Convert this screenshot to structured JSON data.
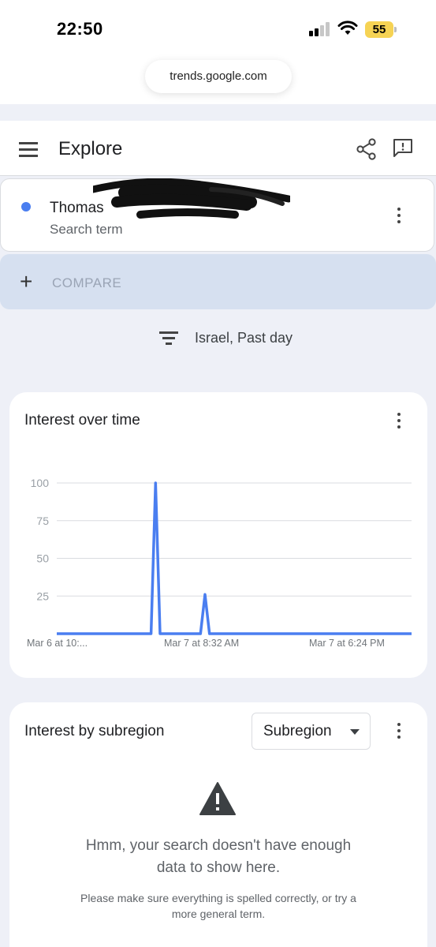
{
  "status_bar": {
    "time": "22:50",
    "battery": "55",
    "url": "trends.google.com"
  },
  "header": {
    "title": "Explore",
    "icons": [
      "menu-icon",
      "share-icon",
      "feedback-icon"
    ]
  },
  "term": {
    "name": "Thomas",
    "sub": "Search term",
    "color": "#4a7ef0"
  },
  "compare": {
    "label": "COMPARE"
  },
  "filter": {
    "label": "Israel, Past day"
  },
  "interest_over_time": {
    "title": "Interest over time"
  },
  "chart_data": {
    "type": "line",
    "y_ticks": [
      "100",
      "75",
      "50",
      "25"
    ],
    "x_tick_labels": [
      "Mar 6 at 10:...",
      "Mar 7 at 8:32 AM",
      "Mar 7 at 6:24 PM"
    ],
    "ylim": [
      0,
      100
    ],
    "grid": true,
    "series_color": "#4a7ef0",
    "values": [
      0,
      0,
      0,
      0,
      0,
      0,
      0,
      0,
      0,
      0,
      0,
      0,
      0,
      0,
      0,
      0,
      0,
      0,
      0,
      0,
      0,
      0,
      100,
      0,
      0,
      0,
      0,
      0,
      0,
      0,
      0,
      0,
      0,
      26,
      0,
      0,
      0,
      0,
      0,
      0,
      0,
      0,
      0,
      0,
      0,
      0,
      0,
      0,
      0,
      0,
      0,
      0,
      0,
      0,
      0,
      0,
      0,
      0,
      0,
      0,
      0,
      0,
      0,
      0,
      0,
      0,
      0,
      0,
      0,
      0,
      0,
      0,
      0,
      0,
      0,
      0,
      0,
      0,
      0,
      0
    ]
  },
  "subregion": {
    "title": "Interest by subregion",
    "dropdown": "Subregion",
    "message": "Hmm, your search doesn't have enough data to show here.",
    "hint": "Please make sure everything is spelled correctly, or try a more general term."
  }
}
